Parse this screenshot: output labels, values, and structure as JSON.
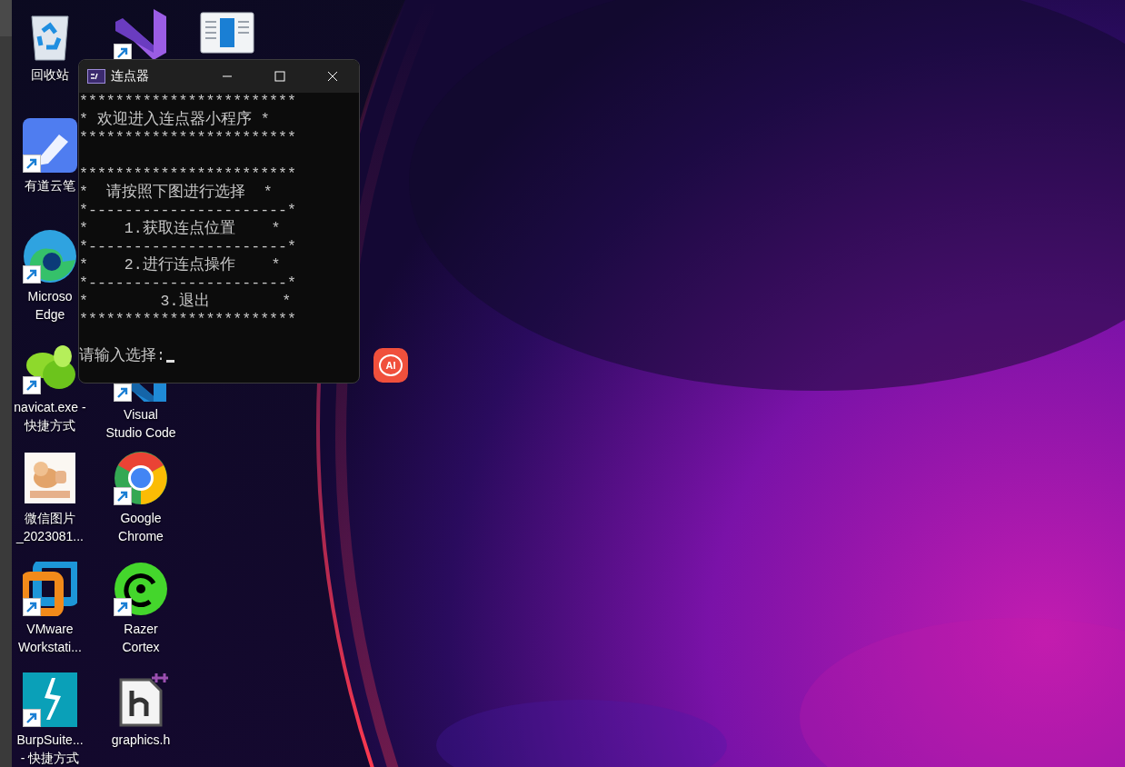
{
  "desktop": {
    "icons": [
      {
        "kind": "recycle-bin",
        "label": "回收站",
        "shortcut": false
      },
      {
        "kind": "pen",
        "label": "有道云笔",
        "shortcut": true
      },
      {
        "kind": "swirl",
        "label": "Microso\nEdge",
        "shortcut": true
      },
      {
        "kind": "leaf",
        "label": "navicat.exe -\n快捷方式",
        "shortcut": true
      },
      {
        "label": "微信图片\n_2023081...",
        "shortcut": false
      },
      {
        "kind": "squares",
        "label": "VMware\nWorkstati...",
        "shortcut": true
      },
      {
        "kind": "lightning",
        "label": "BurpSuite...\n- 快捷方式",
        "shortcut": true
      },
      {
        "kind": "ribbon",
        "shortcut": true
      },
      {
        "kind": "document",
        "shortcut": false
      },
      {
        "kind": "ribbon-blue",
        "label": "Visual\nStudio Code",
        "shortcut": true
      },
      {
        "kind": "ring",
        "label": "Google\nChrome",
        "shortcut": true
      },
      {
        "kind": "gauge",
        "label": "Razer\nCortex",
        "shortcut": true
      },
      {
        "kind": "header-file",
        "label": "graphics.h",
        "shortcut": false
      }
    ]
  },
  "console_window": {
    "title": "连点器",
    "blocks": [
      [
        "************************",
        "* 欢迎进入连点器小程序 *",
        "************************"
      ],
      [
        "************************",
        "*  请按照下图进行选择  *",
        "*----------------------*",
        "*    1.获取连点位置    *",
        "*----------------------*",
        "*    2.进行连点操作    *",
        "*----------------------*",
        "*        3.退出        *",
        "************************"
      ]
    ],
    "prompt": "请输入选择:",
    "cursor": true
  },
  "floating_button": {
    "label": "AI"
  }
}
